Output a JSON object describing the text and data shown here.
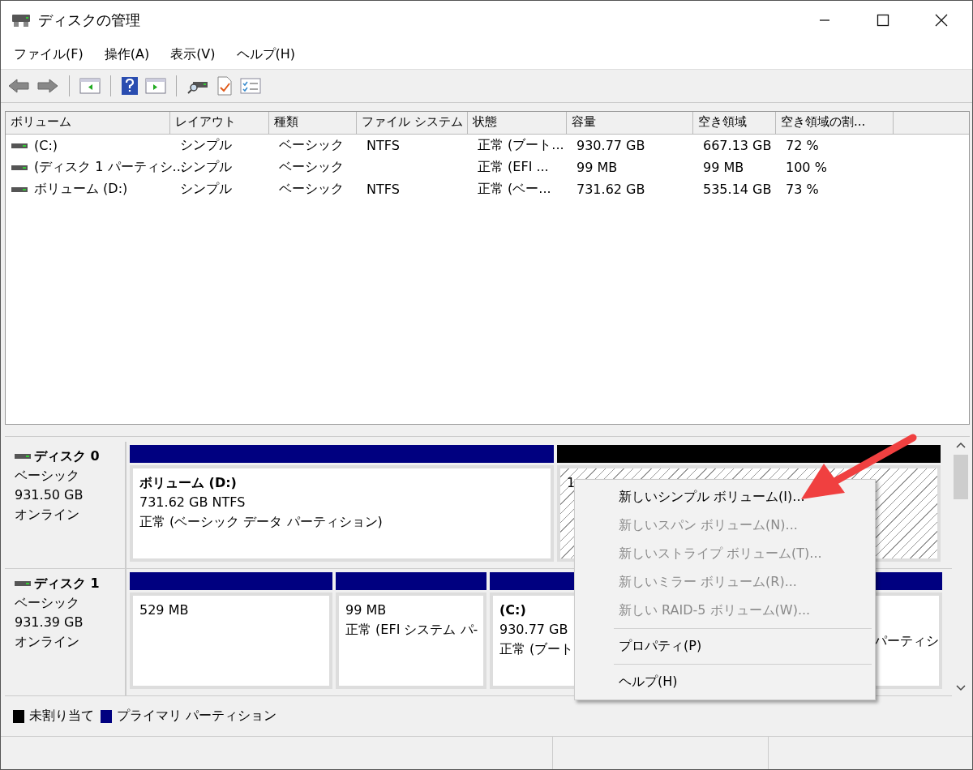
{
  "window": {
    "title": "ディスクの管理"
  },
  "menu": [
    "ファイル(F)",
    "操作(A)",
    "表示(V)",
    "ヘルプ(H)"
  ],
  "volume_table": {
    "columns": [
      "ボリューム",
      "レイアウト",
      "種類",
      "ファイル システム",
      "状態",
      "容量",
      "空き領域",
      "空き領域の割..."
    ],
    "rows": [
      {
        "cells": [
          "(C:)",
          "シンプル",
          "ベーシック",
          "NTFS",
          "正常 (ブート...",
          "930.77 GB",
          "667.13 GB",
          "72 %"
        ]
      },
      {
        "cells": [
          "(ディスク 1 パーティシ...",
          "シンプル",
          "ベーシック",
          "",
          "正常 (EFI ...",
          "99 MB",
          "99 MB",
          "100 %"
        ]
      },
      {
        "cells": [
          "ボリューム (D:)",
          "シンプル",
          "ベーシック",
          "NTFS",
          "正常 (ベー...",
          "731.62 GB",
          "535.14 GB",
          "73 %"
        ]
      }
    ]
  },
  "disks": [
    {
      "name": "ディスク 0",
      "type": "ベーシック",
      "size": "931.50 GB",
      "status": "オンライン",
      "partitions": [
        {
          "kind": "primary",
          "title": "ボリューム  (D:)",
          "lines": [
            "731.62 GB NTFS",
            "正常 (ベーシック データ パーティション)"
          ]
        },
        {
          "kind": "unallocated",
          "lines": [
            "1"
          ]
        }
      ]
    },
    {
      "name": "ディスク 1",
      "type": "ベーシック",
      "size": "931.39 GB",
      "status": "オンライン",
      "partitions": [
        {
          "kind": "primary",
          "lines": [
            "529 MB"
          ]
        },
        {
          "kind": "primary",
          "lines": [
            "99 MB",
            "正常 (EFI システム パ-"
          ]
        },
        {
          "kind": "primary",
          "title": "(C:)",
          "lines": [
            "930.77 GB",
            "正常 (ブート"
          ]
        },
        {
          "kind": "primary",
          "lines": [
            "パーティシ"
          ]
        }
      ]
    }
  ],
  "legend": [
    {
      "label": "未割り当て",
      "color": "#000000"
    },
    {
      "label": "プライマリ パーティション",
      "color": "#000080"
    }
  ],
  "context_menu": {
    "items": [
      {
        "label": "新しいシンプル ボリューム(I)...",
        "disabled": false,
        "separator_before": false
      },
      {
        "label": "新しいスパン ボリューム(N)...",
        "disabled": true,
        "separator_before": false
      },
      {
        "label": "新しいストライプ ボリューム(T)...",
        "disabled": true,
        "separator_before": false
      },
      {
        "label": "新しいミラー ボリューム(R)...",
        "disabled": true,
        "separator_before": false
      },
      {
        "label": "新しい RAID-5 ボリューム(W)...",
        "disabled": true,
        "separator_before": false
      },
      {
        "label": "プロパティ(P)",
        "disabled": false,
        "separator_before": true
      },
      {
        "label": "ヘルプ(H)",
        "disabled": false,
        "separator_before": true
      }
    ]
  }
}
